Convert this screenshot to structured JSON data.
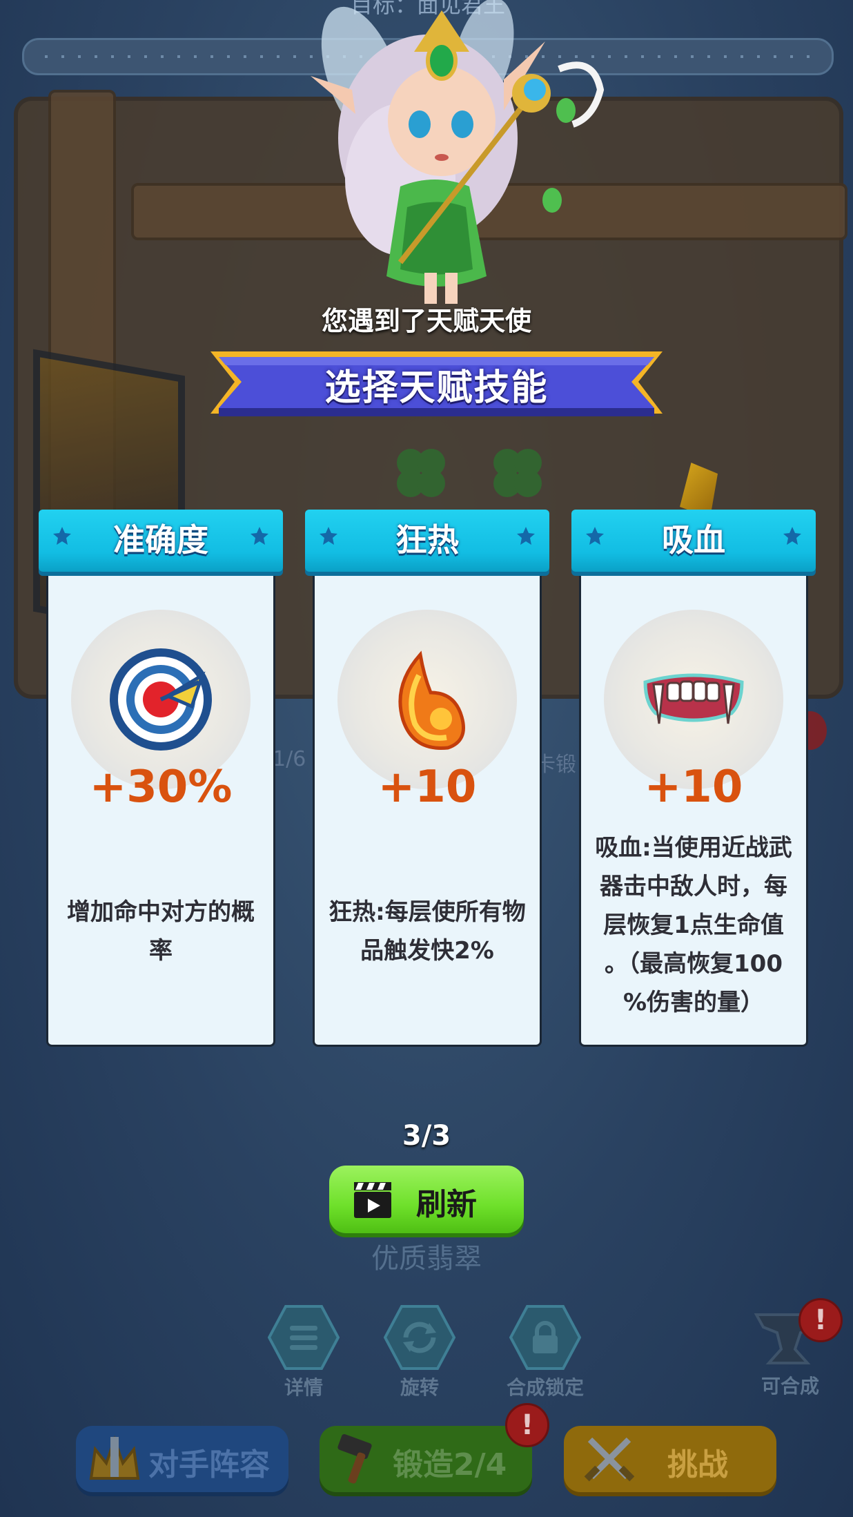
{
  "background": {
    "top_title": "目标：面见君王",
    "ghost_left": "1/6",
    "ghost_right": "卡锻"
  },
  "encounter": {
    "text": "您遇到了天赋天使"
  },
  "banner": {
    "title": "选择天赋技能"
  },
  "cards": [
    {
      "title": "准确度",
      "value": "+30%",
      "icon": "target-icon",
      "desc_lines": [
        "增加命中对方的概",
        "率"
      ]
    },
    {
      "title": "狂热",
      "value": "+10",
      "icon": "flame-wing-icon",
      "desc_lines": [
        "狂热:每层使所有物",
        "品触发快2%"
      ]
    },
    {
      "title": "吸血",
      "value": "+10",
      "icon": "fangs-icon",
      "desc_lines": [
        "吸血:当使用近战武",
        "器击中敌人时，每",
        "层恢复1点生命值",
        "。（最高恢复100",
        "%伤害的量）"
      ]
    }
  ],
  "refresh": {
    "count": "3/3",
    "label": "刷新",
    "icon": "clapperboard-icon"
  },
  "quality_label": "优质翡翠",
  "tools": [
    {
      "label": "详情",
      "icon": "list-icon"
    },
    {
      "label": "旋转",
      "icon": "rotate-icon"
    },
    {
      "label": "合成锁定",
      "icon": "lock-icon"
    }
  ],
  "craft": {
    "label": "可合成",
    "alert": "!",
    "icon": "anvil-icon"
  },
  "bottom_buttons": [
    {
      "label": "对手阵容",
      "icon": "crown-icon",
      "color": "#2c5fae"
    },
    {
      "label": "锻造2/4",
      "icon": "hammer-icon",
      "color": "#3f8a1d",
      "alert": "!"
    },
    {
      "label": "挑战",
      "icon": "crossed-swords-icon",
      "color": "#b88b12"
    }
  ],
  "colors": {
    "card_header": "#12bde3",
    "card_value": "#d9520f",
    "refresh_button": "#6ee02a",
    "banner": "#4a4fd6"
  }
}
